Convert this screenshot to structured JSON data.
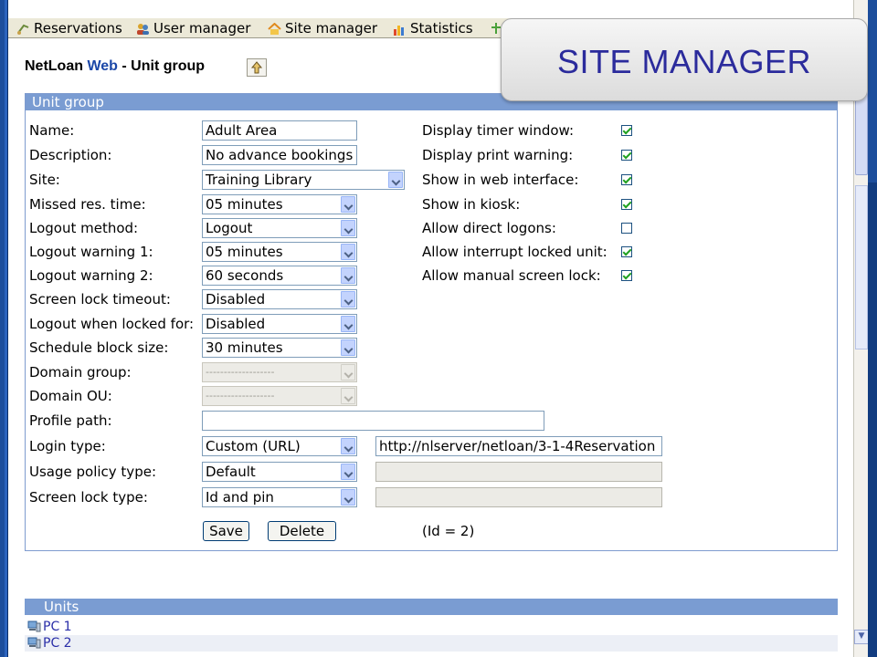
{
  "nav": {
    "reservations": "Reservations",
    "user_manager": "User manager",
    "site_manager": "Site manager",
    "statistics": "Statistics"
  },
  "page_title": {
    "app": "NetLoan",
    "web": "Web",
    "suffix": "- Unit group"
  },
  "callout": {
    "text": "SITE MANAGER"
  },
  "panel": {
    "header": "Unit group"
  },
  "form": {
    "name_label": "Name:",
    "name_value": "Adult Area",
    "description_label": "Description:",
    "description_value": "No advance bookings",
    "site_label": "Site:",
    "site_value": "Training Library",
    "missed_label": "Missed res. time:",
    "missed_value": "05 minutes",
    "logout_method_label": "Logout method:",
    "logout_method_value": "Logout",
    "warning1_label": "Logout warning 1:",
    "warning1_value": "05 minutes",
    "warning2_label": "Logout warning 2:",
    "warning2_value": "60 seconds",
    "screenlock_timeout_label": "Screen lock timeout:",
    "screenlock_timeout_value": "Disabled",
    "logout_locked_label": "Logout when locked for:",
    "logout_locked_value": "Disabled",
    "schedule_label": "Schedule block size:",
    "schedule_value": "30 minutes",
    "domain_group_label": "Domain group:",
    "domain_group_value": "-------------------",
    "domain_ou_label": "Domain OU:",
    "domain_ou_value": "-------------------",
    "profile_label": "Profile path:",
    "profile_value": "",
    "login_type_label": "Login type:",
    "login_type_value": "Custom (URL)",
    "login_url_value": "http://nlserver/netloan/3-1-4Reservation",
    "usage_policy_label": "Usage policy type:",
    "usage_policy_value": "Default",
    "usage_policy_extra": "",
    "screen_lock_type_label": "Screen lock type:",
    "screen_lock_type_value": "Id and pin",
    "screen_lock_type_extra": ""
  },
  "options": {
    "timer_label": "Display timer window:",
    "timer_checked": true,
    "print_label": "Display print warning:",
    "print_checked": true,
    "web_label": "Show in web interface:",
    "web_checked": true,
    "kiosk_label": "Show in kiosk:",
    "kiosk_checked": true,
    "direct_label": "Allow direct logons:",
    "direct_checked": false,
    "interrupt_label": "Allow interrupt locked unit:",
    "interrupt_checked": true,
    "manual_lock_label": "Allow manual screen lock:",
    "manual_lock_checked": true
  },
  "actions": {
    "save": "Save",
    "delete": "Delete",
    "id_text": "(Id = 2)"
  },
  "units": {
    "header": "Units",
    "items": [
      {
        "label": "PC 1"
      },
      {
        "label": "PC 2"
      }
    ]
  },
  "colors": {
    "accent": "#7a9cd2",
    "frame": "#1d4e9c",
    "callout_text": "#2b2b9c",
    "check": "#21a121"
  }
}
